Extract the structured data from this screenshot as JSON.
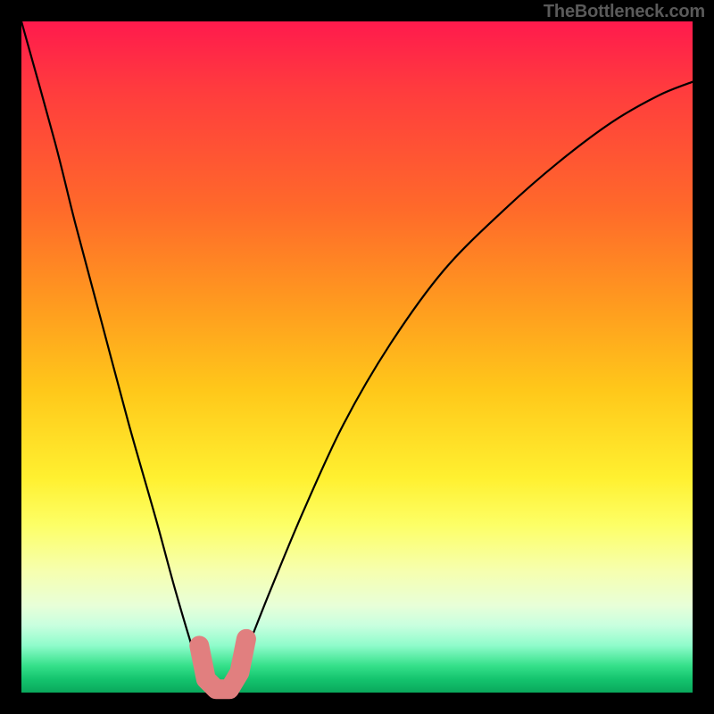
{
  "watermark": "TheBottleneck.com",
  "colors": {
    "frame_background": "#000000",
    "curve": "#000000",
    "marker": "#e17f7f",
    "gradient_top": "#ff1a4d",
    "gradient_bottom": "#0aa85c"
  },
  "chart_data": {
    "type": "line",
    "title": "",
    "xlabel": "",
    "ylabel": "",
    "xlim": [
      0,
      100
    ],
    "ylim": [
      0,
      100
    ],
    "x": [
      0,
      5,
      8,
      12,
      16,
      20,
      23,
      26,
      27.5,
      29,
      31,
      33,
      37,
      42,
      48,
      55,
      63,
      72,
      80,
      88,
      95,
      100
    ],
    "y": [
      100,
      82,
      70,
      55,
      40,
      26,
      15,
      5,
      1,
      0,
      1,
      5,
      15,
      27,
      40,
      52,
      63,
      72,
      79,
      85,
      89,
      91
    ],
    "series": [
      {
        "name": "bottleneck-curve",
        "note": "V-shaped curve; y roughly proportional to distance from optimum at x≈29",
        "minimum_x": 29,
        "minimum_y": 0
      }
    ],
    "markers": {
      "note": "Salmon-colored U-shaped highlight at curve minimum",
      "points": [
        {
          "x": 26.5,
          "y": 7
        },
        {
          "x": 27.5,
          "y": 2
        },
        {
          "x": 29,
          "y": 0.5
        },
        {
          "x": 31,
          "y": 0.5
        },
        {
          "x": 32.5,
          "y": 3
        },
        {
          "x": 33.5,
          "y": 8
        }
      ]
    }
  }
}
